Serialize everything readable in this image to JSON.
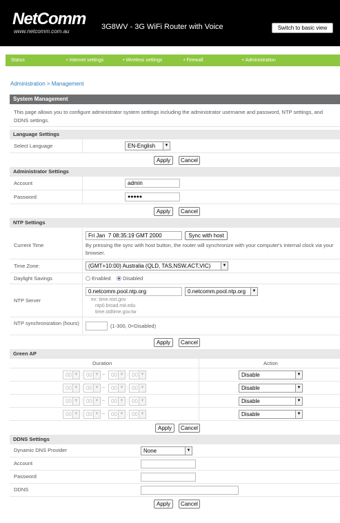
{
  "header": {
    "logo_text": "NetComm",
    "logo_subtext": "www.netcomm.com.au",
    "title": "3G8WV - 3G WiFi Router with Voice",
    "basic_view_button": "Switch to basic view"
  },
  "nav": {
    "items": [
      {
        "label": "Status",
        "bullet": false
      },
      {
        "label": "Internet settings",
        "bullet": true
      },
      {
        "label": "Wireless settings",
        "bullet": true
      },
      {
        "label": "Firewall",
        "bullet": true
      },
      {
        "label": "Administration",
        "bullet": true
      }
    ]
  },
  "breadcrumb": "Administration > Management",
  "system": {
    "title": "System Management",
    "description": "This page allows you to configure administrator system settings including the administrator username and password, NTP settings, and DDNS settings."
  },
  "language": {
    "title": "Language Settings",
    "label": "Select Language",
    "value": "EN-English"
  },
  "buttons": {
    "apply": "Apply",
    "cancel": "Cancel"
  },
  "admin": {
    "title": "Administrator Settings",
    "account_label": "Account",
    "account_value": "admin",
    "password_label": "Password",
    "password_value": "●●●●●"
  },
  "ntp": {
    "title": "NTP Settings",
    "current_time_label": "Current Time",
    "current_time_value": "Fri Jan  7 08:35:19 GMT 2000",
    "sync_button": "Sync with host",
    "sync_note": "By pressing the sync with host button, the router will synchronize with your computer's internal clock via your browser.",
    "timezone_label": "Time Zone:",
    "timezone_value": "(GMT+10:00) Australia (QLD, TAS,NSW,ACT,VIC)",
    "daylight_label": "Daylight Savings",
    "enabled_label": "Enabled",
    "disabled_label": "Disabled",
    "daylight_selected": "Disabled",
    "server_label": "NTP Server",
    "server_value": "0.netcomm.pool.ntp.org",
    "server_select": "0.netcomm.pool.ntp.org",
    "server_examples": [
      "ex: time.nist.gov",
      "ntp0.broad.mit.edu",
      "time.stdtime.gov.tw"
    ],
    "sync_label": "NTP synchronization (hours)",
    "sync_value": "",
    "sync_hint": "(1-300, 0=Disabled)"
  },
  "green_ap": {
    "title": "Green AP",
    "duration_header": "Duration",
    "action_header": "Action",
    "rows": [
      {
        "start_h": "00",
        "start_m": "00",
        "end_h": "00",
        "end_m": "00",
        "action": "Disable"
      },
      {
        "start_h": "00",
        "start_m": "00",
        "end_h": "00",
        "end_m": "00",
        "action": "Disable"
      },
      {
        "start_h": "00",
        "start_m": "00",
        "end_h": "00",
        "end_m": "00",
        "action": "Disable"
      },
      {
        "start_h": "00",
        "start_m": "00",
        "end_h": "00",
        "end_m": "00",
        "action": "Disable"
      }
    ],
    "colon": ":",
    "dash": "~"
  },
  "ddns": {
    "title": "DDNS Settings",
    "provider_label": "Dynamic DNS Provider",
    "provider_value": "None",
    "account_label": "Account",
    "password_label": "Password",
    "ddns_label": "DDNS",
    "account_value": "",
    "password_value": "",
    "ddns_value": ""
  }
}
